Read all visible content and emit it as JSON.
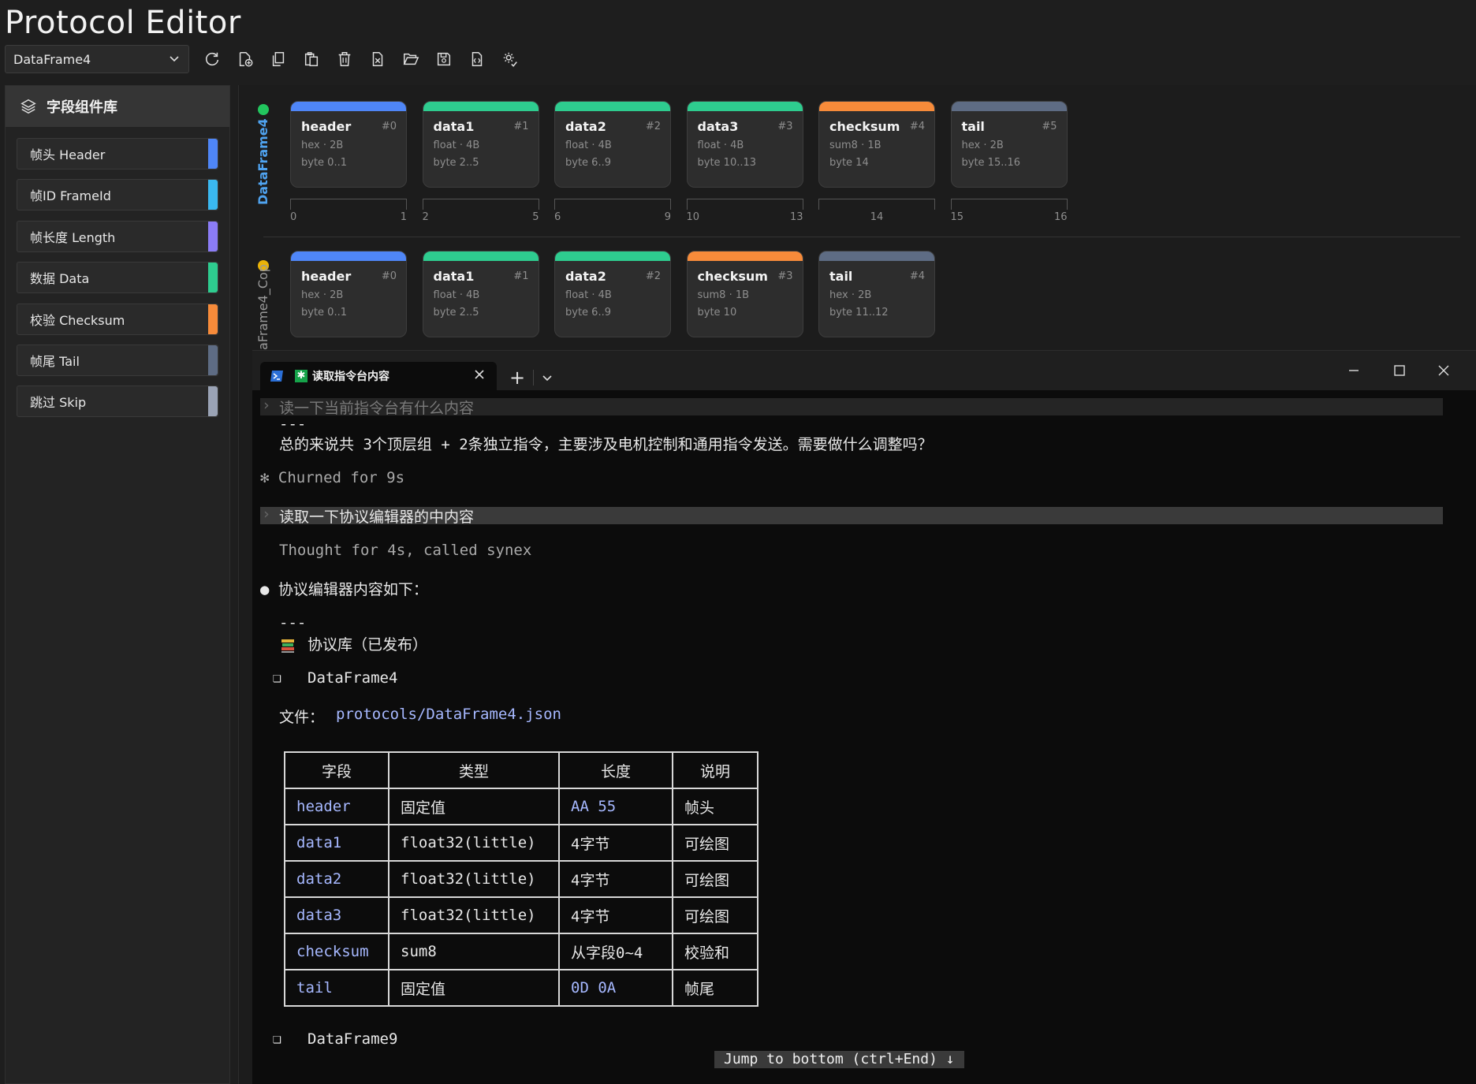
{
  "app": {
    "title": "Protocol Editor"
  },
  "toolbar": {
    "selected_frame": "DataFrame4",
    "buttons": [
      "refresh-icon",
      "new-file-icon",
      "copy-icon",
      "paste-icon",
      "delete-icon",
      "clear-icon",
      "open-folder-icon",
      "save-icon",
      "export-code-icon",
      "settings-check-icon"
    ]
  },
  "sidebar": {
    "title": "字段组件库",
    "items": [
      {
        "label": "帧头 Header",
        "color": "#4f86f7"
      },
      {
        "label": "帧ID FrameId",
        "color": "#3ab8f0"
      },
      {
        "label": "帧长度 Length",
        "color": "#8b7cf6"
      },
      {
        "label": "数据 Data",
        "color": "#2ecc8f"
      },
      {
        "label": "校验 Checksum",
        "color": "#f78b3a"
      },
      {
        "label": "帧尾 Tail",
        "color": "#5e6c84"
      },
      {
        "label": "跳过 Skip",
        "color": "#9aa3b5"
      }
    ]
  },
  "frames": [
    {
      "name": "DataFrame4",
      "status_color": "#22c55e",
      "fields": [
        {
          "name": "header",
          "idx": "#0",
          "type": "hex · 2B",
          "range": "byte 0..1",
          "color": "#4f86f7"
        },
        {
          "name": "data1",
          "idx": "#1",
          "type": "float · 4B",
          "range": "byte 2..5",
          "color": "#2ecc8f"
        },
        {
          "name": "data2",
          "idx": "#2",
          "type": "float · 4B",
          "range": "byte 6..9",
          "color": "#2ecc8f"
        },
        {
          "name": "data3",
          "idx": "#3",
          "type": "float · 4B",
          "range": "byte 10..13",
          "color": "#2ecc8f"
        },
        {
          "name": "checksum",
          "idx": "#4",
          "type": "sum8 · 1B",
          "range": "byte 14",
          "color": "#f78b3a"
        },
        {
          "name": "tail",
          "idx": "#5",
          "type": "hex · 2B",
          "range": "byte 15..16",
          "color": "#5e6c84"
        }
      ],
      "ruler": [
        [
          "0",
          "1"
        ],
        [
          "2",
          "5"
        ],
        [
          "6",
          "9"
        ],
        [
          "10",
          "13"
        ],
        [
          "",
          "14"
        ],
        [
          "15",
          "16"
        ]
      ]
    },
    {
      "name": "aFrame4_Cop",
      "status_color": "#eab308",
      "fields": [
        {
          "name": "header",
          "idx": "#0",
          "type": "hex · 2B",
          "range": "byte 0..1",
          "color": "#4f86f7"
        },
        {
          "name": "data1",
          "idx": "#1",
          "type": "float · 4B",
          "range": "byte 2..5",
          "color": "#2ecc8f"
        },
        {
          "name": "data2",
          "idx": "#2",
          "type": "float · 4B",
          "range": "byte 6..9",
          "color": "#2ecc8f"
        },
        {
          "name": "checksum",
          "idx": "#3",
          "type": "sum8 · 1B",
          "range": "byte 10",
          "color": "#f78b3a"
        },
        {
          "name": "tail",
          "idx": "#4",
          "type": "hex · 2B",
          "range": "byte 11..12",
          "color": "#5e6c84"
        }
      ]
    }
  ],
  "terminal": {
    "tab_title": "读取指令台内容",
    "lines": {
      "prompt1": "读一下当前指令台有什么内容",
      "sep1": "---",
      "summary": "总的来说共 3个顶层组 + 2条独立指令，主要涉及电机控制和通用指令发送。需要做什么调整吗？",
      "churned": "✻ Churned for 9s",
      "prompt2": "读取一下协议编辑器的中内容",
      "thought": "Thought for 4s, called synex",
      "bullet": "● 协议编辑器内容如下：",
      "sep2": "---",
      "library": "协议库（已发布）",
      "frame1": "DataFrame4",
      "file_label": "文件：",
      "file_path": "protocols/DataFrame4.json",
      "frame2": "DataFrame9",
      "jump": "Jump to bottom (ctrl+End) ↓"
    },
    "table": {
      "headers": [
        "字段",
        "类型",
        "长度",
        "说明"
      ],
      "rows": [
        [
          "header",
          "固定值",
          "AA 55",
          "帧头"
        ],
        [
          "data1",
          "float32(little)",
          "4字节",
          "可绘图"
        ],
        [
          "data2",
          "float32(little)",
          "4字节",
          "可绘图"
        ],
        [
          "data3",
          "float32(little)",
          "4字节",
          "可绘图"
        ],
        [
          "checksum",
          "sum8",
          "从字段0~4",
          "校验和"
        ],
        [
          "tail",
          "固定值",
          "0D 0A",
          "帧尾"
        ]
      ]
    }
  }
}
